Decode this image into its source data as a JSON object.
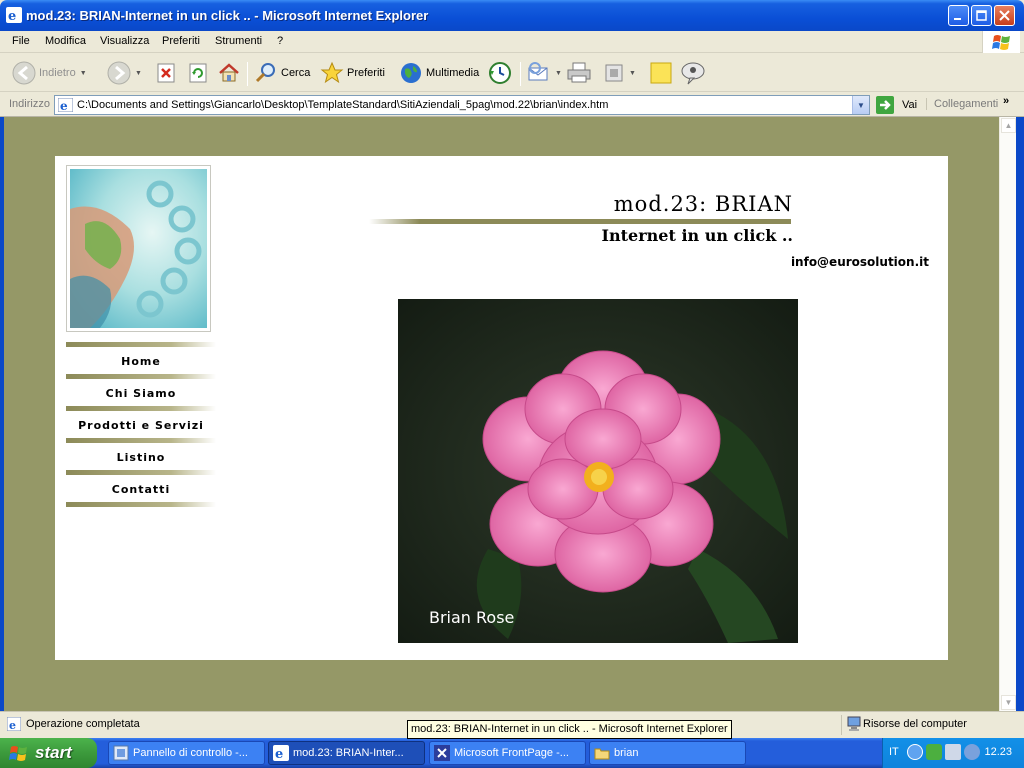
{
  "window": {
    "title": "mod.23: BRIAN-Internet in un click .. - Microsoft Internet Explorer"
  },
  "menu": {
    "items": [
      "File",
      "Modifica",
      "Visualizza",
      "Preferiti",
      "Strumenti",
      "?"
    ]
  },
  "toolbar": {
    "back": "Indietro",
    "search": "Cerca",
    "favorites": "Preferiti",
    "media": "Multimedia"
  },
  "address": {
    "label": "Indirizzo",
    "url": "C:\\Documents and Settings\\Giancarlo\\Desktop\\TemplateStandard\\SitiAziendali_5pag\\mod.22\\brian\\index.htm",
    "go": "Vai",
    "links": "Collegamenti"
  },
  "page": {
    "site_title": "mod.23: BRIAN",
    "subtitle": "Internet in un click ..",
    "email": "info@eurosolution.it",
    "nav": [
      "Home",
      "Chi Siamo",
      "Prodotti e Servizi",
      "Listino",
      "Contatti"
    ],
    "hero_caption": "Brian Rose",
    "colors": {
      "background": "#959867",
      "accent_rule": "#8c8a58"
    }
  },
  "status": {
    "text": "Operazione completata",
    "zone": "Risorse del computer",
    "tooltip": "mod.23: BRIAN-Internet in un click .. - Microsoft Internet Explorer"
  },
  "taskbar": {
    "start": "start",
    "tasks": [
      "Pannello di controllo -...",
      "mod.23: BRIAN-Inter...",
      "Microsoft FrontPage -...",
      "brian"
    ],
    "language": "IT",
    "clock": "12.23"
  }
}
